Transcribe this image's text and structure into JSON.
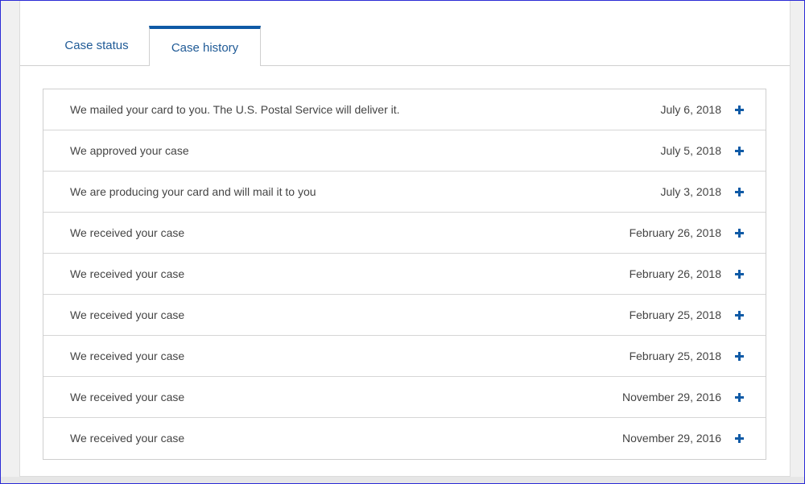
{
  "tabs": {
    "status_label": "Case status",
    "history_label": "Case history"
  },
  "colors": {
    "accent": "#0f5aa6",
    "tab_text": "#1f5a96",
    "row_text": "#444444",
    "border": "#cfcfcf"
  },
  "history": [
    {
      "text": "We mailed your card to you. The U.S. Postal Service will deliver it.",
      "date": "July 6, 2018",
      "icon": "plus-icon"
    },
    {
      "text": "We approved your case",
      "date": "July 5, 2018",
      "icon": "plus-icon"
    },
    {
      "text": "We are producing your card and will mail it to you",
      "date": "July 3, 2018",
      "icon": "plus-icon"
    },
    {
      "text": "We received your case",
      "date": "February 26, 2018",
      "icon": "plus-icon"
    },
    {
      "text": "We received your case",
      "date": "February 26, 2018",
      "icon": "plus-icon"
    },
    {
      "text": "We received your case",
      "date": "February 25, 2018",
      "icon": "plus-icon"
    },
    {
      "text": "We received your case",
      "date": "February 25, 2018",
      "icon": "plus-icon"
    },
    {
      "text": "We received your case",
      "date": "November 29, 2016",
      "icon": "plus-icon"
    },
    {
      "text": "We received your case",
      "date": "November 29, 2016",
      "icon": "plus-icon"
    }
  ]
}
